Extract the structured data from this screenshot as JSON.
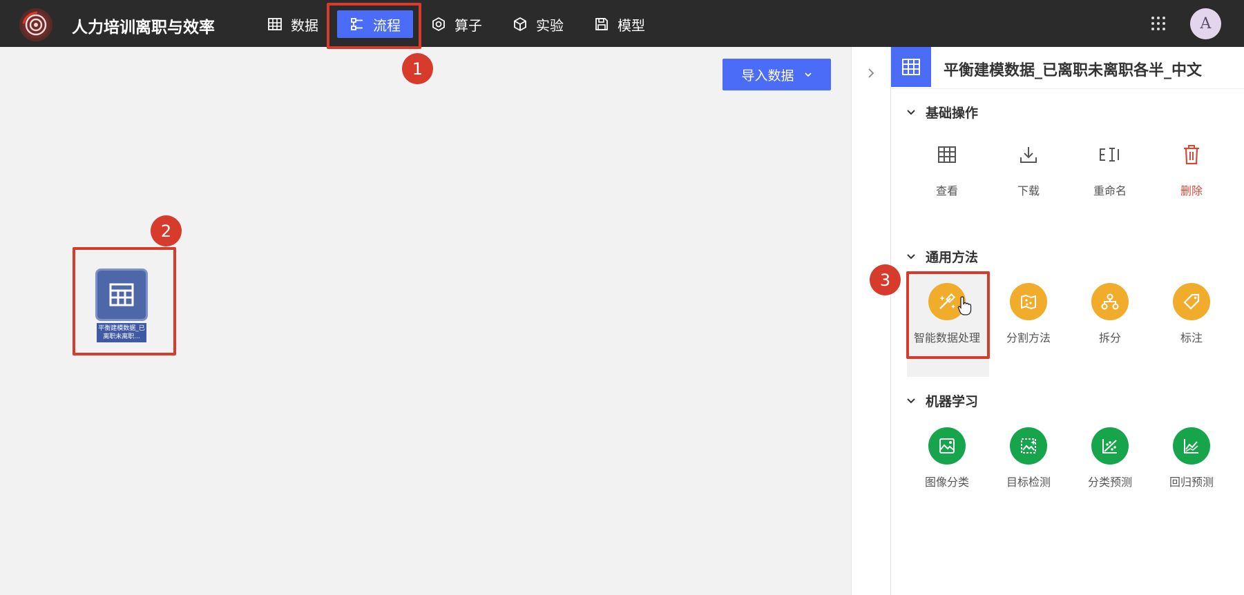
{
  "app": {
    "title": "人力培训离职与效率",
    "avatar_letter": "A"
  },
  "nav": [
    {
      "label": "数据",
      "icon": "table-icon"
    },
    {
      "label": "流程",
      "icon": "flow-icon",
      "active": true
    },
    {
      "label": "算子",
      "icon": "operator-icon"
    },
    {
      "label": "实验",
      "icon": "cube-icon"
    },
    {
      "label": "模型",
      "icon": "save-icon"
    }
  ],
  "canvas": {
    "import_button": "导入数据",
    "node_label": "平衡建模数据_已离职未离职..."
  },
  "panel": {
    "title": "平衡建模数据_已离职未离职各半_中文",
    "sections": [
      {
        "title": "基础操作",
        "tools": [
          "查看",
          "下载",
          "重命名",
          "删除"
        ]
      },
      {
        "title": "通用方法",
        "tools": [
          "智能数据处理",
          "分割方法",
          "拆分",
          "标注"
        ]
      },
      {
        "title": "机器学习",
        "tools": [
          "图像分类",
          "目标检测",
          "分类预测",
          "回归预测"
        ]
      }
    ]
  },
  "annotations": {
    "step1": "1",
    "step2": "2",
    "step3": "3"
  },
  "colors": {
    "accent": "#4a6cf7",
    "highlight": "#d63b2c",
    "orange": "#f0ac2a",
    "green": "#17a54b",
    "danger": "#d14b3c"
  }
}
